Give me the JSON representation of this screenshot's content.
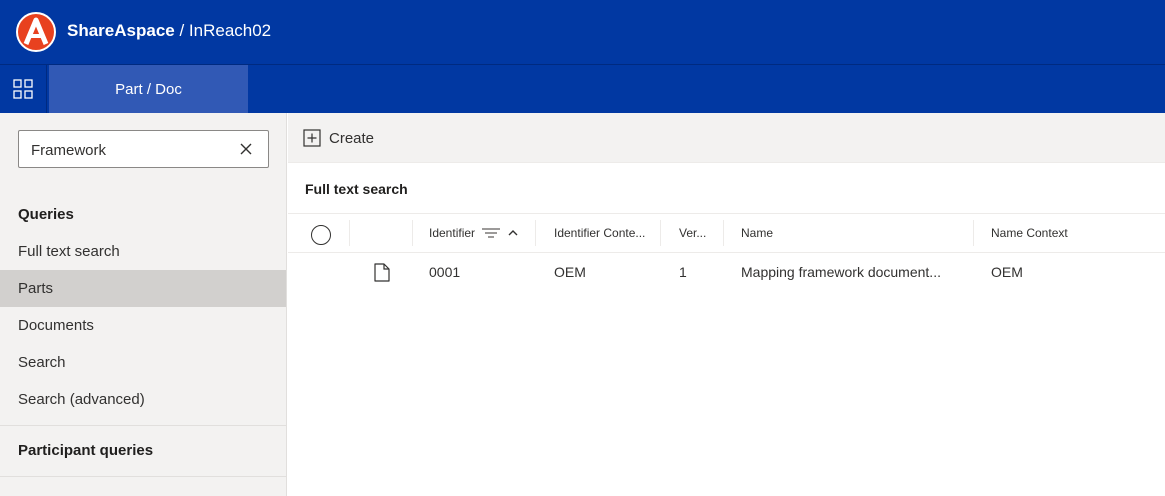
{
  "header": {
    "brand": "ShareAspace",
    "separator": " / ",
    "collection": "InReach02"
  },
  "nav": {
    "active_tab": "Part / Doc"
  },
  "sidebar": {
    "search": {
      "value": "Framework",
      "placeholder": ""
    },
    "queries_heading": "Queries",
    "items": [
      {
        "label": "Full text search"
      },
      {
        "label": "Parts"
      },
      {
        "label": "Documents"
      },
      {
        "label": "Search"
      },
      {
        "label": "Search (advanced)"
      }
    ],
    "participant_heading": "Participant queries"
  },
  "toolbar": {
    "create_label": "Create"
  },
  "results": {
    "title": "Full text search",
    "columns": [
      "Identifier",
      "Identifier Conte...",
      "Ver...",
      "Name",
      "Name Context"
    ],
    "rows": [
      {
        "identifier": "0001",
        "identifier_context": "OEM",
        "version": "1",
        "name": "Mapping framework document...",
        "name_context": "OEM"
      }
    ]
  },
  "colors": {
    "header_bg": "#0138a2",
    "active_tab_bg": "#3159b5",
    "selected_item_bg": "#d2d0ce",
    "logo_red": "#e8411f"
  }
}
